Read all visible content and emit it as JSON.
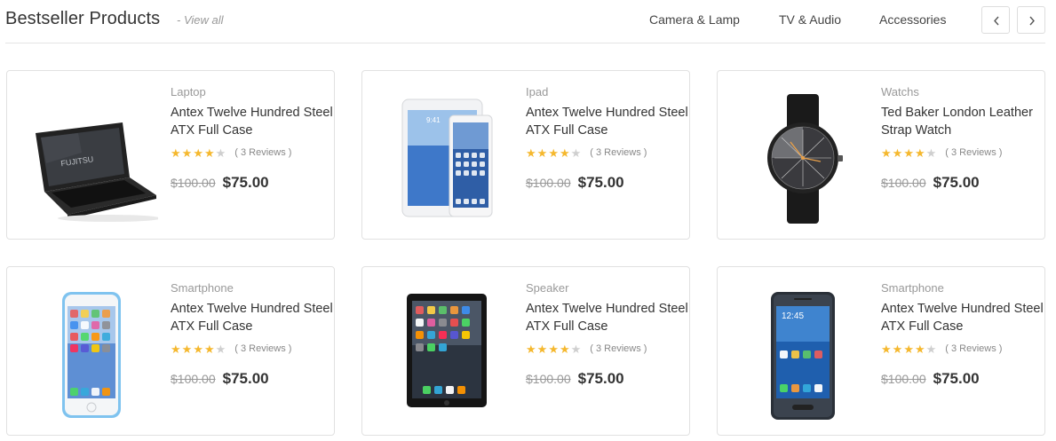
{
  "header": {
    "title": "Bestseller Products",
    "view_all": "- View all",
    "tabs": [
      "Camera & Lamp",
      "TV & Audio",
      "Accessories"
    ]
  },
  "products": [
    {
      "category": "Laptop",
      "name": "Antex Twelve Hundred Steel ATX Full Case",
      "reviews": "( 3 Reviews )",
      "old_price": "$100.00",
      "price": "$75.00",
      "rating": 4,
      "image": "laptop-image"
    },
    {
      "category": "Ipad",
      "name": "Antex Twelve Hundred Steel ATX Full Case",
      "reviews": "( 3 Reviews )",
      "old_price": "$100.00",
      "price": "$75.00",
      "rating": 4,
      "image": "ipad-image"
    },
    {
      "category": "Watchs",
      "name": "Ted Baker London Leather Strap Watch",
      "reviews": "( 3 Reviews )",
      "old_price": "$100.00",
      "price": "$75.00",
      "rating": 4,
      "image": "watch-image"
    },
    {
      "category": "Smartphone",
      "name": "Antex Twelve Hundred Steel ATX Full Case",
      "reviews": "( 3 Reviews )",
      "old_price": "$100.00",
      "price": "$75.00",
      "rating": 4,
      "image": "iphone-image"
    },
    {
      "category": "Speaker",
      "name": "Antex Twelve Hundred Steel ATX Full Case",
      "reviews": "( 3 Reviews )",
      "old_price": "$100.00",
      "price": "$75.00",
      "rating": 4,
      "image": "tablet-image"
    },
    {
      "category": "Smartphone",
      "name": "Antex Twelve Hundred Steel ATX Full Case",
      "reviews": "( 3 Reviews )",
      "old_price": "$100.00",
      "price": "$75.00",
      "rating": 4,
      "image": "samsung-phone-image"
    }
  ],
  "colors": {
    "star": "#f5b82e",
    "star_off": "#cfcfcf",
    "border": "#e1e1e1"
  }
}
